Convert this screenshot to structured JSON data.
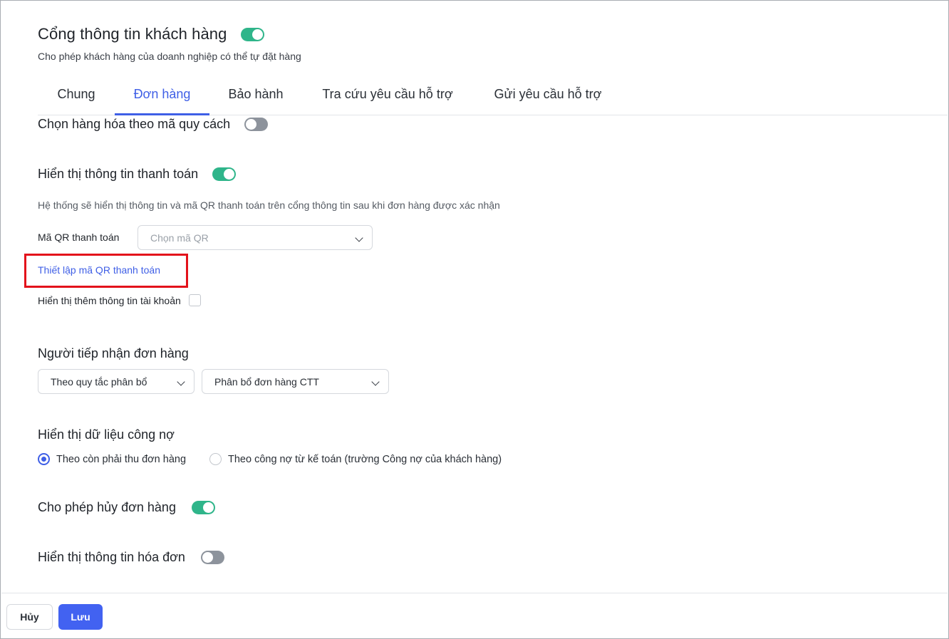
{
  "header": {
    "title": "Cổng thông tin khách hàng",
    "subtitle": "Cho phép khách hàng của doanh nghiệp có thể tự đặt hàng",
    "enabled": true
  },
  "tabs": [
    {
      "label": "Chung",
      "active": false
    },
    {
      "label": "Đơn hàng",
      "active": true
    },
    {
      "label": "Bảo hành",
      "active": false
    },
    {
      "label": "Tra cứu yêu cầu hỗ trợ",
      "active": false
    },
    {
      "label": "Gửi yêu cầu hỗ trợ",
      "active": false
    }
  ],
  "spec_code": {
    "label": "Chọn hàng hóa theo mã quy cách",
    "enabled": false
  },
  "payment": {
    "label": "Hiển thị thông tin thanh toán",
    "enabled": true,
    "description": "Hệ thống sẽ hiển thị thông tin và mã QR thanh toán trên cổng thông tin sau khi đơn hàng được xác nhận",
    "qr_label": "Mã QR thanh toán",
    "qr_placeholder": "Chọn mã QR",
    "setup_link": "Thiết lập mã QR thanh toán",
    "account_info_label": "Hiển thị thêm thông tin tài khoản",
    "account_info_checked": false
  },
  "receiver": {
    "label": "Người tiếp nhận đơn hàng",
    "rule_value": "Theo quy tắc phân bổ",
    "allocation_value": "Phân bổ đơn hàng CTT"
  },
  "debt": {
    "label": "Hiển thị dữ liệu công nợ",
    "options": [
      {
        "label": "Theo còn phải thu đơn hàng",
        "checked": true
      },
      {
        "label": "Theo công nợ từ kế toán (trường Công nợ của khách hàng)",
        "checked": false
      }
    ]
  },
  "cancel_order": {
    "label": "Cho phép hủy đơn hàng",
    "enabled": true
  },
  "invoice": {
    "label": "Hiển thị thông tin hóa đơn",
    "enabled": false
  },
  "footer": {
    "cancel_label": "Hủy",
    "save_label": "Lưu"
  },
  "colors": {
    "accent": "#3f5fe6",
    "toggle_on": "#2fb58a",
    "toggle_off": "#8d939c",
    "highlight": "#e3121b",
    "primary_button": "#4262f1"
  }
}
